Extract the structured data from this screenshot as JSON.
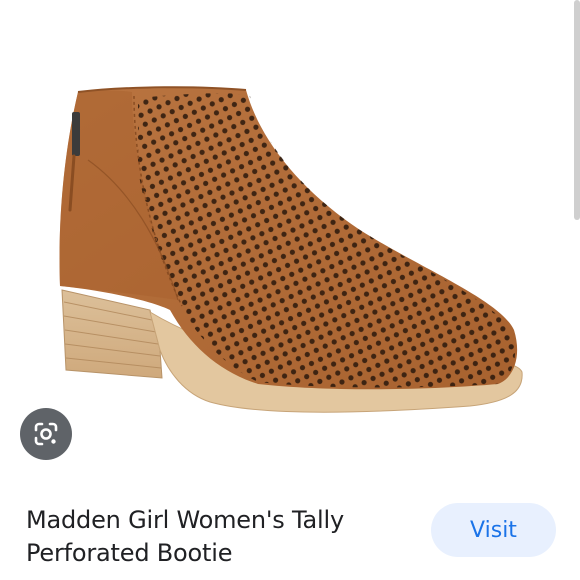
{
  "product": {
    "title_line1": "Madden Girl Women's Tally",
    "title_line2": "Perforated Bootie",
    "image_icon": "ankle-boot-image"
  },
  "actions": {
    "visit_label": "Visit",
    "lens_icon": "google-lens-icon"
  },
  "colors": {
    "accent": "#1a73e8",
    "visit_bg": "#e8f0fe",
    "lens_bg": "#5f6368",
    "boot_leather": "#b8733f",
    "heel_wood": "#d9b88c",
    "sole": "#e2c69c"
  }
}
